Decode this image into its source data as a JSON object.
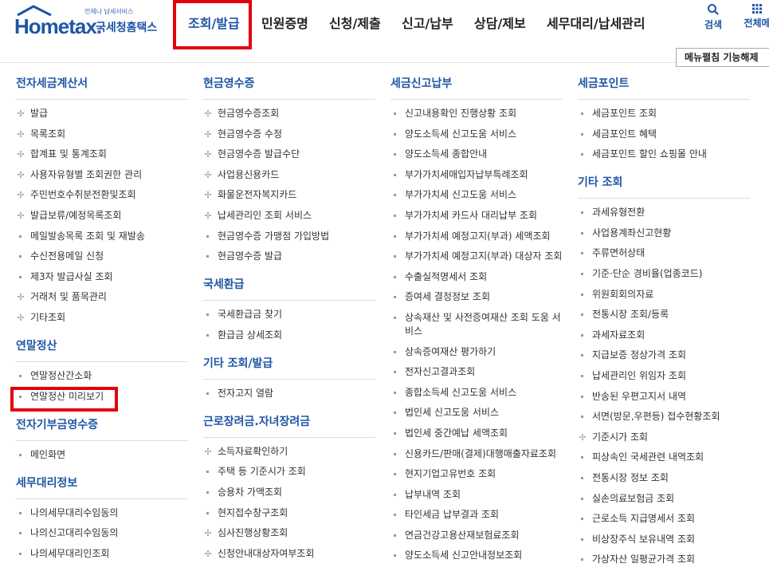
{
  "logo": {
    "tagline": "언제나 납세서비스",
    "name": "Hometax.",
    "korean": "국세청홈택스"
  },
  "nav": [
    {
      "label": "조회/발급",
      "active": true
    },
    {
      "label": "민원증명"
    },
    {
      "label": "신청/제출"
    },
    {
      "label": "신고/납부"
    },
    {
      "label": "상담/제보"
    },
    {
      "label": "세무대리/납세관리"
    }
  ],
  "util": {
    "search": "검색",
    "all_menu": "전체메"
  },
  "collapse_button": "메뉴펼침 기능해제",
  "colors": {
    "brand": "#1f56a5",
    "highlight": "#e2000f"
  },
  "columns": [
    [
      {
        "title": "전자세금계산서",
        "items": [
          {
            "label": "발급",
            "icon": "plus-cross-icon"
          },
          {
            "label": "목록조회",
            "icon": "plus-cross-icon"
          },
          {
            "label": "합계표 및 통계조회",
            "icon": "plus-cross-icon"
          },
          {
            "label": "사용자유형별 조회권한 관리",
            "icon": "plus-cross-icon"
          },
          {
            "label": "주민번호수취분전환및조회",
            "icon": "plus-cross-icon"
          },
          {
            "label": "발급보류/예정목록조회",
            "icon": "plus-cross-icon"
          },
          {
            "label": "메일발송목록 조회 및 재발송",
            "icon": "square-bullet-icon"
          },
          {
            "label": "수신전용메일 신청",
            "icon": "square-bullet-icon"
          },
          {
            "label": "제3자 발급사실 조회",
            "icon": "square-bullet-icon"
          },
          {
            "label": "거래처 및 품목관리",
            "icon": "plus-cross-icon"
          },
          {
            "label": "기타조회",
            "icon": "plus-cross-icon"
          }
        ]
      },
      {
        "title": "연말정산",
        "items": [
          {
            "label": "연말정산간소화",
            "icon": "square-bullet-icon"
          },
          {
            "label": "연말정산 미리보기",
            "icon": "square-bullet-icon",
            "highlighted": true
          }
        ]
      },
      {
        "title": "전자기부금영수증",
        "items": [
          {
            "label": "메인화면",
            "icon": "square-bullet-icon"
          }
        ]
      },
      {
        "title": "세무대리정보",
        "items": [
          {
            "label": "나의세무대리수임동의",
            "icon": "square-bullet-icon"
          },
          {
            "label": "나의신고대리수임동의",
            "icon": "square-bullet-icon"
          },
          {
            "label": "나의세무대리인조회",
            "icon": "square-bullet-icon"
          }
        ]
      }
    ],
    [
      {
        "title": "현금영수증",
        "items": [
          {
            "label": "현금영수증조회",
            "icon": "plus-cross-icon"
          },
          {
            "label": "현금영수증 수정",
            "icon": "plus-cross-icon"
          },
          {
            "label": "현금영수증 발급수단",
            "icon": "plus-cross-icon"
          },
          {
            "label": "사업용신용카드",
            "icon": "plus-cross-icon"
          },
          {
            "label": "화물운전자복지카드",
            "icon": "plus-cross-icon"
          },
          {
            "label": "납세관리인 조회 서비스",
            "icon": "plus-cross-icon"
          },
          {
            "label": "현금영수증 가맹점 가입방법",
            "icon": "square-bullet-icon"
          },
          {
            "label": "현금영수증 발급",
            "icon": "square-bullet-icon"
          }
        ]
      },
      {
        "title": "국세환급",
        "items": [
          {
            "label": "국세환급금 찾기",
            "icon": "square-bullet-icon"
          },
          {
            "label": "환급금 상세조회",
            "icon": "square-bullet-icon"
          }
        ]
      },
      {
        "title": "기타 조회/발급",
        "items": [
          {
            "label": "전자고지 열람",
            "icon": "square-bullet-icon"
          }
        ]
      },
      {
        "title": "근로장려금.자녀장려금",
        "items": [
          {
            "label": "소득자료확인하기",
            "icon": "plus-cross-icon"
          },
          {
            "label": "주택 등 기준시가 조회",
            "icon": "square-bullet-icon"
          },
          {
            "label": "승용차 가액조회",
            "icon": "square-bullet-icon"
          },
          {
            "label": "현지접수창구조회",
            "icon": "square-bullet-icon"
          },
          {
            "label": "심사진행상황조회",
            "icon": "plus-cross-icon"
          },
          {
            "label": "신청안내대상자여부조회",
            "icon": "plus-cross-icon"
          }
        ]
      }
    ],
    [
      {
        "title": "세금신고납부",
        "items": [
          {
            "label": "신고내용확인 진행상황 조회",
            "icon": "square-bullet-icon"
          },
          {
            "label": "양도소득세 신고도움 서비스",
            "icon": "square-bullet-icon"
          },
          {
            "label": "양도소득세 종합안내",
            "icon": "square-bullet-icon"
          },
          {
            "label": "부가가치세매입자납부특례조회",
            "icon": "square-bullet-icon"
          },
          {
            "label": "부가가치세 신고도움 서비스",
            "icon": "square-bullet-icon"
          },
          {
            "label": "부가가치세 카드사 대리납부 조회",
            "icon": "square-bullet-icon"
          },
          {
            "label": "부가가치세 예정고지(부과) 세액조회",
            "icon": "square-bullet-icon"
          },
          {
            "label": "부가가치세 예정고지(부과) 대상자 조회",
            "icon": "square-bullet-icon"
          },
          {
            "label": "수출실적명세서 조회",
            "icon": "square-bullet-icon"
          },
          {
            "label": "증여세 결정정보 조회",
            "icon": "square-bullet-icon"
          },
          {
            "label": "상속재산 및 사전증여재산 조회 도움 서비스",
            "icon": "square-bullet-icon"
          },
          {
            "label": "상속증여재산 평가하기",
            "icon": "square-bullet-icon"
          },
          {
            "label": "전자신고결과조회",
            "icon": "square-bullet-icon"
          },
          {
            "label": "종합소득세 신고도움 서비스",
            "icon": "square-bullet-icon"
          },
          {
            "label": "법인세 신고도움 서비스",
            "icon": "square-bullet-icon"
          },
          {
            "label": "법인세 중간예납 세액조회",
            "icon": "square-bullet-icon"
          },
          {
            "label": "신용카드/판매(결제)대행매출자료조회",
            "icon": "square-bullet-icon"
          },
          {
            "label": "현지기업고유번호 조회",
            "icon": "square-bullet-icon"
          },
          {
            "label": "납부내역 조회",
            "icon": "square-bullet-icon"
          },
          {
            "label": "타인세금 납부결과 조회",
            "icon": "square-bullet-icon"
          },
          {
            "label": "연금건강고용산재보험료조회",
            "icon": "square-bullet-icon"
          },
          {
            "label": "양도소득세 신고안내정보조회",
            "icon": "square-bullet-icon"
          }
        ]
      }
    ],
    [
      {
        "title": "세금포인트",
        "items": [
          {
            "label": "세금포인트 조회",
            "icon": "square-bullet-icon"
          },
          {
            "label": "세금포인트 혜택",
            "icon": "square-bullet-icon"
          },
          {
            "label": "세금포인트 할인 쇼핑몰 안내",
            "icon": "square-bullet-icon"
          }
        ]
      },
      {
        "title": "기타 조회",
        "items": [
          {
            "label": "과세유형전환",
            "icon": "square-bullet-icon"
          },
          {
            "label": "사업용계좌신고현황",
            "icon": "square-bullet-icon"
          },
          {
            "label": "주류면허상태",
            "icon": "square-bullet-icon"
          },
          {
            "label": "기준·단순 경비율(업종코드)",
            "icon": "square-bullet-icon"
          },
          {
            "label": "위원회회의자료",
            "icon": "square-bullet-icon"
          },
          {
            "label": "전통시장 조회/등록",
            "icon": "square-bullet-icon"
          },
          {
            "label": "과세자료조회",
            "icon": "square-bullet-icon"
          },
          {
            "label": "지급보증 정상가격 조회",
            "icon": "square-bullet-icon"
          },
          {
            "label": "납세관리인 위임자 조회",
            "icon": "square-bullet-icon"
          },
          {
            "label": "반송된 우편고지서 내역",
            "icon": "square-bullet-icon"
          },
          {
            "label": "서면(방문,우편등) 접수현황조회",
            "icon": "square-bullet-icon"
          },
          {
            "label": "기준시가 조회",
            "icon": "plus-cross-icon"
          },
          {
            "label": "피상속인 국세관련 내역조회",
            "icon": "square-bullet-icon"
          },
          {
            "label": "전통시장 정보 조회",
            "icon": "square-bullet-icon"
          },
          {
            "label": "실손의료보험금 조회",
            "icon": "square-bullet-icon"
          },
          {
            "label": "근로소득 지급명세서 조회",
            "icon": "square-bullet-icon"
          },
          {
            "label": "비상장주식 보유내역 조회",
            "icon": "square-bullet-icon"
          },
          {
            "label": "가상자산 일평균가격 조회",
            "icon": "square-bullet-icon"
          }
        ]
      }
    ]
  ]
}
